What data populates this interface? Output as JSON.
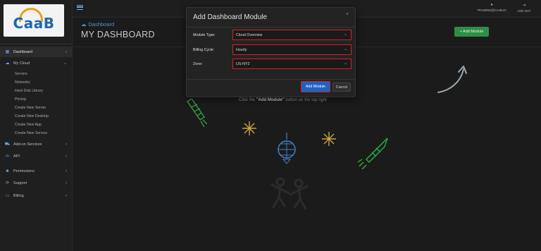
{
  "brand": {
    "logo_text": "CaaB"
  },
  "topbar": {
    "username": "TRAINING@CAAB.IO",
    "logout_label": "LOG OUT"
  },
  "sidebar": {
    "items": [
      {
        "label": "Dashboard",
        "icon": "dashboard-icon"
      },
      {
        "label": "My Cloud",
        "icon": "cloud-icon"
      },
      {
        "label": "Add-on Services",
        "icon": "addon-icon"
      },
      {
        "label": "API",
        "icon": "code-icon"
      },
      {
        "label": "Permissions",
        "icon": "users-icon"
      },
      {
        "label": "Support",
        "icon": "support-icon"
      },
      {
        "label": "Billing",
        "icon": "billing-icon"
      }
    ],
    "my_cloud_subitems": [
      "Servers",
      "Networks",
      "Hard Disk Library",
      "Pricing",
      "Create New Server",
      "Create New Desktop",
      "Create New App",
      "Create New Service"
    ]
  },
  "header": {
    "breadcrumb": "Dashboard",
    "title": "MY DASHBOARD",
    "add_module_label": "+ Add Module"
  },
  "empty_hint": {
    "prefix": "Click the ",
    "bold": "\"Add Module\"",
    "suffix": " button on the top right"
  },
  "modal": {
    "title": "Add Dashboard Module",
    "close_glyph": "×",
    "fields": [
      {
        "label": "Module Type:",
        "value": "Cloud Overview"
      },
      {
        "label": "Billing Cycle:",
        "value": "Hourly"
      },
      {
        "label": "Zone:",
        "value": "US-NY2"
      }
    ],
    "submit_label": "Add Module",
    "cancel_label": "Cancel"
  },
  "colors": {
    "accent_blue": "#4f95d8",
    "primary_button": "#1f62c4",
    "success_green": "#2f8e45",
    "highlight_red": "#d0202a",
    "logo_orange": "#e6a11a"
  }
}
